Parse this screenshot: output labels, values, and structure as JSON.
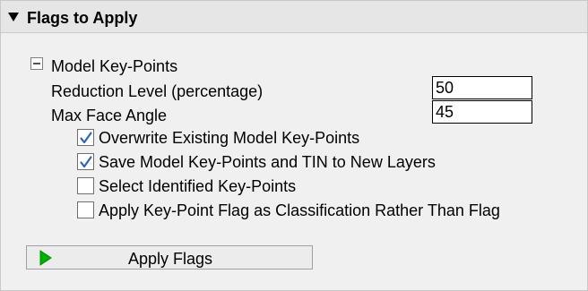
{
  "panel": {
    "title": "Flags to Apply",
    "expanded": true
  },
  "group": {
    "title": "Model Key-Points",
    "expanded": true
  },
  "fields": {
    "reduction_label": "Reduction Level (percentage)",
    "reduction_value": "50",
    "angle_label": "Max Face Angle",
    "angle_value": "45"
  },
  "options": [
    {
      "label": "Overwrite Existing Model Key-Points",
      "checked": true
    },
    {
      "label": "Save Model Key-Points and TIN to New Layers",
      "checked": true
    },
    {
      "label": "Select Identified Key-Points",
      "checked": false
    },
    {
      "label": "Apply Key-Point Flag as Classification Rather Than Flag",
      "checked": false
    }
  ],
  "apply_button": {
    "label": "Apply Flags",
    "icon": "play-icon",
    "icon_color": "#00b000"
  },
  "colors": {
    "check_color": "#2f63b9",
    "header_bg": "#e6e6e6",
    "panel_bg": "#f0f0f0"
  }
}
